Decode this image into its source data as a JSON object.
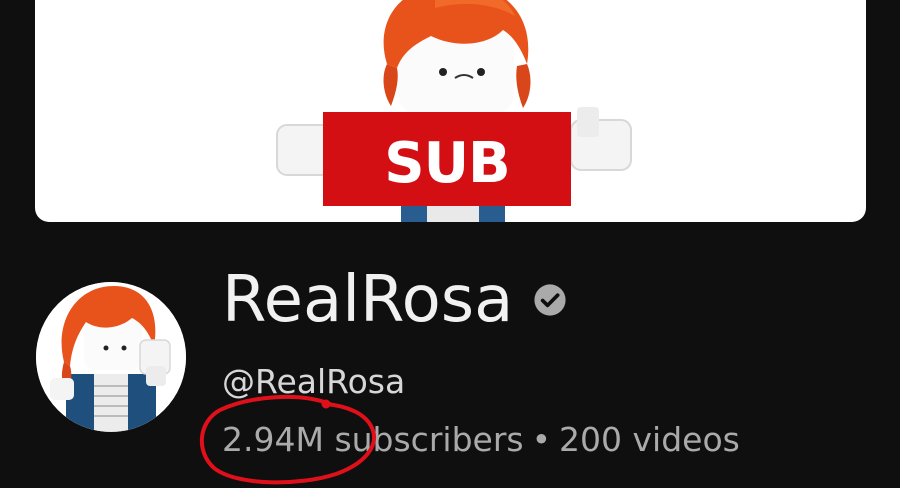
{
  "banner": {
    "sub_text": "SUB",
    "accent_color": "#d40f14"
  },
  "channel": {
    "name": "RealRosa",
    "handle": "@RealRosa",
    "subscribers": "2.94M subscribers",
    "separator": "•",
    "videos": "200 videos",
    "verified_icon": "verified-check-icon"
  },
  "colors": {
    "background": "#0f0f0f",
    "text_primary": "#f1f1f1",
    "text_secondary": "#aaaaaa",
    "annotation": "#e0101a"
  }
}
